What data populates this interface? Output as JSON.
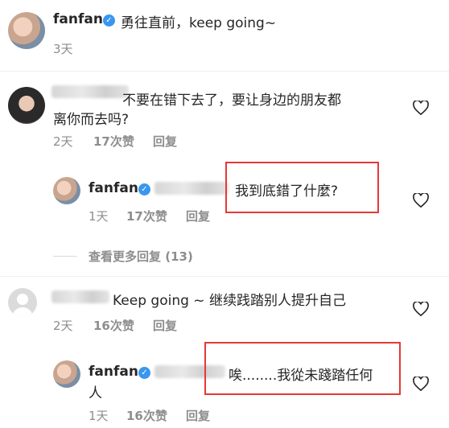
{
  "post": {
    "username": "fanfan",
    "caption": "勇往直前，keep going~",
    "time": "3天"
  },
  "comments": [
    {
      "text_line1": "不要在错下去了，要让身边的朋友都",
      "text_line2": "离你而去吗?",
      "time": "2天",
      "likes": "17次赞",
      "reply": "回复",
      "reply_item": {
        "username": "fanfan",
        "text": "我到底錯了什麼?",
        "time": "1天",
        "likes": "17次赞",
        "reply": "回复"
      }
    },
    {
      "text": "Keep going ~ 继续践踏别人提升自己",
      "time": "2天",
      "likes": "16次赞",
      "reply": "回复",
      "reply_item": {
        "username": "fanfan",
        "text_line1": "唉........我從未踐踏任何",
        "text_line2": "人",
        "time": "1天",
        "likes": "16次赞",
        "reply": "回复"
      }
    }
  ],
  "view_more": "查看更多回复 (13)",
  "colors": {
    "verified": "#3897f0",
    "highlight": "#e53935",
    "meta": "#8e8e8e"
  }
}
